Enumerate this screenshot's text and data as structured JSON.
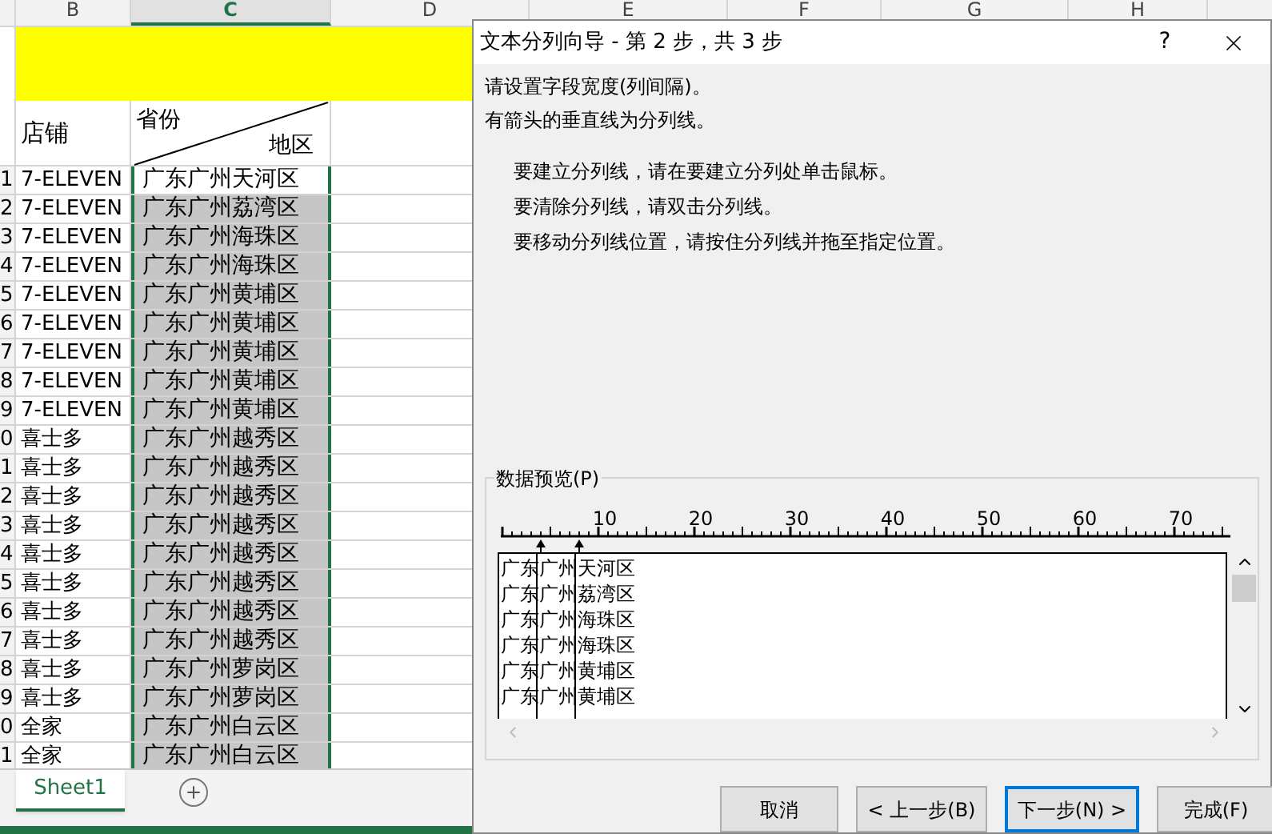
{
  "spreadsheet": {
    "column_headers": [
      {
        "label": "B",
        "selected": false
      },
      {
        "label": "C",
        "selected": true
      },
      {
        "label": "D",
        "selected": false
      },
      {
        "label": "E",
        "selected": false
      },
      {
        "label": "F",
        "selected": false
      },
      {
        "label": "G",
        "selected": false
      },
      {
        "label": "H",
        "selected": false
      }
    ],
    "header_row": {
      "store": "店铺",
      "province": "省份",
      "district": "地区"
    },
    "rows": [
      {
        "number": "1",
        "store": "7-ELEVEN",
        "region": "广东广州天河区",
        "active": true
      },
      {
        "number": "2",
        "store": "7-ELEVEN",
        "region": "广东广州荔湾区",
        "active": false
      },
      {
        "number": "3",
        "store": "7-ELEVEN",
        "region": "广东广州海珠区",
        "active": false
      },
      {
        "number": "4",
        "store": "7-ELEVEN",
        "region": "广东广州海珠区",
        "active": false
      },
      {
        "number": "5",
        "store": "7-ELEVEN",
        "region": "广东广州黄埔区",
        "active": false
      },
      {
        "number": "6",
        "store": "7-ELEVEN",
        "region": "广东广州黄埔区",
        "active": false
      },
      {
        "number": "7",
        "store": "7-ELEVEN",
        "region": "广东广州黄埔区",
        "active": false
      },
      {
        "number": "8",
        "store": "7-ELEVEN",
        "region": "广东广州黄埔区",
        "active": false
      },
      {
        "number": "9",
        "store": "7-ELEVEN",
        "region": "广东广州黄埔区",
        "active": false
      },
      {
        "number": "0",
        "store": "喜士多",
        "region": "广东广州越秀区",
        "active": false
      },
      {
        "number": "1",
        "store": "喜士多",
        "region": "广东广州越秀区",
        "active": false
      },
      {
        "number": "2",
        "store": "喜士多",
        "region": "广东广州越秀区",
        "active": false
      },
      {
        "number": "3",
        "store": "喜士多",
        "region": "广东广州越秀区",
        "active": false
      },
      {
        "number": "4",
        "store": "喜士多",
        "region": "广东广州越秀区",
        "active": false
      },
      {
        "number": "5",
        "store": "喜士多",
        "region": "广东广州越秀区",
        "active": false
      },
      {
        "number": "6",
        "store": "喜士多",
        "region": "广东广州越秀区",
        "active": false
      },
      {
        "number": "7",
        "store": "喜士多",
        "region": "广东广州越秀区",
        "active": false
      },
      {
        "number": "8",
        "store": "喜士多",
        "region": "广东广州萝岗区",
        "active": false
      },
      {
        "number": "9",
        "store": "喜士多",
        "region": "广东广州萝岗区",
        "active": false
      },
      {
        "number": "0",
        "store": "全家",
        "region": "广东广州白云区",
        "active": false
      },
      {
        "number": "1",
        "store": "全家",
        "region": "广东广州白云区",
        "active": false
      }
    ],
    "sheet_tabs": [
      {
        "label": "Sheet1",
        "selected": true
      }
    ]
  },
  "dialog": {
    "title": "文本分列向导 - 第 2 步，共 3 步",
    "help": "?",
    "intro": [
      "请设置字段宽度(列间隔)。",
      "有箭头的垂直线为分列线。"
    ],
    "instructions": [
      "要建立分列线，请在要建立分列处单击鼠标。",
      "要清除分列线，请双击分列线。",
      "要移动分列线位置，请按住分列线并拖至指定位置。"
    ],
    "preview": {
      "label": "数据预览(P)",
      "ruler_labels": [
        "10",
        "20",
        "30",
        "40",
        "50",
        "60",
        "70"
      ],
      "lines": [
        "广东广州天河区",
        "广东广州荔湾区",
        "广东广州海珠区",
        "广东广州海珠区",
        "广东广州黄埔区",
        "广东广州黄埔区"
      ]
    },
    "buttons": [
      {
        "label": "取消",
        "focused": false
      },
      {
        "label": "< 上一步(B)",
        "focused": false
      },
      {
        "label": "下一步(N) >",
        "focused": true
      },
      {
        "label": "完成(F)",
        "focused": false
      }
    ]
  }
}
